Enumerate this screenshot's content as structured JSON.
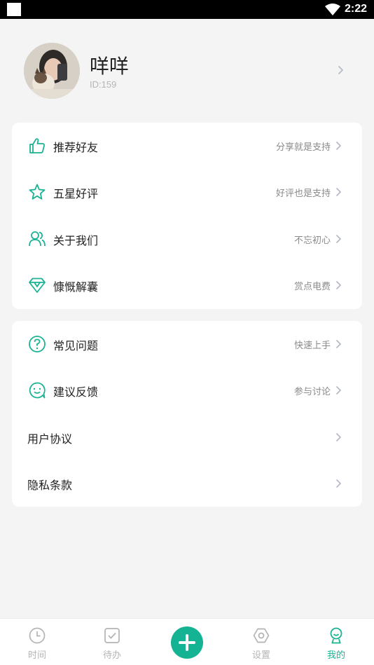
{
  "status_bar": {
    "time": "2:22"
  },
  "profile": {
    "name": "咩咩",
    "id_text": "ID:159"
  },
  "menu_group_1": [
    {
      "icon": "thumbs-up-icon",
      "label": "推荐好友",
      "sub": "分享就是支持"
    },
    {
      "icon": "star-icon",
      "label": "五星好评",
      "sub": "好评也是支持"
    },
    {
      "icon": "users-icon",
      "label": "关于我们",
      "sub": "不忘初心"
    },
    {
      "icon": "diamond-icon",
      "label": "慷慨解囊",
      "sub": "赏点电费"
    }
  ],
  "menu_group_2": [
    {
      "icon": "question-icon",
      "label": "常见问题",
      "sub": "快速上手"
    },
    {
      "icon": "chat-smile-icon",
      "label": "建议反馈",
      "sub": "参与讨论"
    },
    {
      "label": "用户协议"
    },
    {
      "label": "隐私条款"
    }
  ],
  "tabbar": {
    "tabs": [
      {
        "icon": "clock-icon",
        "label": "时间"
      },
      {
        "icon": "checkbox-icon",
        "label": "待办"
      },
      {
        "icon": "hexagon-settings-icon",
        "label": "设置"
      },
      {
        "icon": "profile-icon",
        "label": "我的"
      }
    ],
    "active_index": 3,
    "add_icon": "plus-icon"
  },
  "colors": {
    "accent": "#1cb394",
    "background": "#f4f4f4"
  }
}
